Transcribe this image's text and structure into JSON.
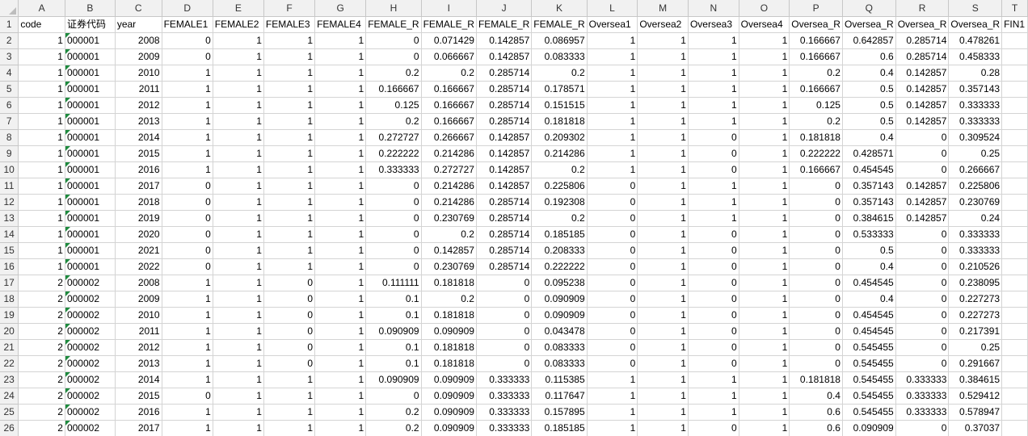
{
  "columns": [
    "A",
    "B",
    "C",
    "D",
    "E",
    "F",
    "G",
    "H",
    "I",
    "J",
    "K",
    "L",
    "M",
    "N",
    "O",
    "P",
    "Q",
    "R",
    "S",
    "T"
  ],
  "rows": [
    {
      "n": "1",
      "c": [
        "code",
        "证券代码",
        "year",
        "FEMALE1",
        "FEMALE2",
        "FEMALE3",
        "FEMALE4",
        "FEMALE_R",
        "FEMALE_R",
        "FEMALE_R",
        "FEMALE_R",
        "Oversea1",
        "Oversea2",
        "Oversea3",
        "Oversea4",
        "Oversea_R",
        "Oversea_R",
        "Oversea_R",
        "Oversea_R",
        "FIN1"
      ]
    },
    {
      "n": "2",
      "c": [
        "1",
        "000001",
        "2008",
        "0",
        "1",
        "1",
        "1",
        "0",
        "0.071429",
        "0.142857",
        "0.086957",
        "1",
        "1",
        "1",
        "1",
        "0.166667",
        "0.642857",
        "0.285714",
        "0.478261",
        ""
      ]
    },
    {
      "n": "3",
      "c": [
        "1",
        "000001",
        "2009",
        "0",
        "1",
        "1",
        "1",
        "0",
        "0.066667",
        "0.142857",
        "0.083333",
        "1",
        "1",
        "1",
        "1",
        "0.166667",
        "0.6",
        "0.285714",
        "0.458333",
        ""
      ]
    },
    {
      "n": "4",
      "c": [
        "1",
        "000001",
        "2010",
        "1",
        "1",
        "1",
        "1",
        "0.2",
        "0.2",
        "0.285714",
        "0.2",
        "1",
        "1",
        "1",
        "1",
        "0.2",
        "0.4",
        "0.142857",
        "0.28",
        ""
      ]
    },
    {
      "n": "5",
      "c": [
        "1",
        "000001",
        "2011",
        "1",
        "1",
        "1",
        "1",
        "0.166667",
        "0.166667",
        "0.285714",
        "0.178571",
        "1",
        "1",
        "1",
        "1",
        "0.166667",
        "0.5",
        "0.142857",
        "0.357143",
        ""
      ]
    },
    {
      "n": "6",
      "c": [
        "1",
        "000001",
        "2012",
        "1",
        "1",
        "1",
        "1",
        "0.125",
        "0.166667",
        "0.285714",
        "0.151515",
        "1",
        "1",
        "1",
        "1",
        "0.125",
        "0.5",
        "0.142857",
        "0.333333",
        ""
      ]
    },
    {
      "n": "7",
      "c": [
        "1",
        "000001",
        "2013",
        "1",
        "1",
        "1",
        "1",
        "0.2",
        "0.166667",
        "0.285714",
        "0.181818",
        "1",
        "1",
        "1",
        "1",
        "0.2",
        "0.5",
        "0.142857",
        "0.333333",
        ""
      ]
    },
    {
      "n": "8",
      "c": [
        "1",
        "000001",
        "2014",
        "1",
        "1",
        "1",
        "1",
        "0.272727",
        "0.266667",
        "0.142857",
        "0.209302",
        "1",
        "1",
        "0",
        "1",
        "0.181818",
        "0.4",
        "0",
        "0.309524",
        ""
      ]
    },
    {
      "n": "9",
      "c": [
        "1",
        "000001",
        "2015",
        "1",
        "1",
        "1",
        "1",
        "0.222222",
        "0.214286",
        "0.142857",
        "0.214286",
        "1",
        "1",
        "0",
        "1",
        "0.222222",
        "0.428571",
        "0",
        "0.25",
        ""
      ]
    },
    {
      "n": "10",
      "c": [
        "1",
        "000001",
        "2016",
        "1",
        "1",
        "1",
        "1",
        "0.333333",
        "0.272727",
        "0.142857",
        "0.2",
        "1",
        "1",
        "0",
        "1",
        "0.166667",
        "0.454545",
        "0",
        "0.266667",
        ""
      ]
    },
    {
      "n": "11",
      "c": [
        "1",
        "000001",
        "2017",
        "0",
        "1",
        "1",
        "1",
        "0",
        "0.214286",
        "0.142857",
        "0.225806",
        "0",
        "1",
        "1",
        "1",
        "0",
        "0.357143",
        "0.142857",
        "0.225806",
        ""
      ]
    },
    {
      "n": "12",
      "c": [
        "1",
        "000001",
        "2018",
        "0",
        "1",
        "1",
        "1",
        "0",
        "0.214286",
        "0.285714",
        "0.192308",
        "0",
        "1",
        "1",
        "1",
        "0",
        "0.357143",
        "0.142857",
        "0.230769",
        ""
      ]
    },
    {
      "n": "13",
      "c": [
        "1",
        "000001",
        "2019",
        "0",
        "1",
        "1",
        "1",
        "0",
        "0.230769",
        "0.285714",
        "0.2",
        "0",
        "1",
        "1",
        "1",
        "0",
        "0.384615",
        "0.142857",
        "0.24",
        ""
      ]
    },
    {
      "n": "14",
      "c": [
        "1",
        "000001",
        "2020",
        "0",
        "1",
        "1",
        "1",
        "0",
        "0.2",
        "0.285714",
        "0.185185",
        "0",
        "1",
        "0",
        "1",
        "0",
        "0.533333",
        "0",
        "0.333333",
        ""
      ]
    },
    {
      "n": "15",
      "c": [
        "1",
        "000001",
        "2021",
        "0",
        "1",
        "1",
        "1",
        "0",
        "0.142857",
        "0.285714",
        "0.208333",
        "0",
        "1",
        "0",
        "1",
        "0",
        "0.5",
        "0",
        "0.333333",
        ""
      ]
    },
    {
      "n": "16",
      "c": [
        "1",
        "000001",
        "2022",
        "0",
        "1",
        "1",
        "1",
        "0",
        "0.230769",
        "0.285714",
        "0.222222",
        "0",
        "1",
        "0",
        "1",
        "0",
        "0.4",
        "0",
        "0.210526",
        ""
      ]
    },
    {
      "n": "17",
      "c": [
        "2",
        "000002",
        "2008",
        "1",
        "1",
        "0",
        "1",
        "0.111111",
        "0.181818",
        "0",
        "0.095238",
        "0",
        "1",
        "0",
        "1",
        "0",
        "0.454545",
        "0",
        "0.238095",
        ""
      ]
    },
    {
      "n": "18",
      "c": [
        "2",
        "000002",
        "2009",
        "1",
        "1",
        "0",
        "1",
        "0.1",
        "0.2",
        "0",
        "0.090909",
        "0",
        "1",
        "0",
        "1",
        "0",
        "0.4",
        "0",
        "0.227273",
        ""
      ]
    },
    {
      "n": "19",
      "c": [
        "2",
        "000002",
        "2010",
        "1",
        "1",
        "0",
        "1",
        "0.1",
        "0.181818",
        "0",
        "0.090909",
        "0",
        "1",
        "0",
        "1",
        "0",
        "0.454545",
        "0",
        "0.227273",
        ""
      ]
    },
    {
      "n": "20",
      "c": [
        "2",
        "000002",
        "2011",
        "1",
        "1",
        "0",
        "1",
        "0.090909",
        "0.090909",
        "0",
        "0.043478",
        "0",
        "1",
        "0",
        "1",
        "0",
        "0.454545",
        "0",
        "0.217391",
        ""
      ]
    },
    {
      "n": "21",
      "c": [
        "2",
        "000002",
        "2012",
        "1",
        "1",
        "0",
        "1",
        "0.1",
        "0.181818",
        "0",
        "0.083333",
        "0",
        "1",
        "0",
        "1",
        "0",
        "0.545455",
        "0",
        "0.25",
        ""
      ]
    },
    {
      "n": "22",
      "c": [
        "2",
        "000002",
        "2013",
        "1",
        "1",
        "0",
        "1",
        "0.1",
        "0.181818",
        "0",
        "0.083333",
        "0",
        "1",
        "0",
        "1",
        "0",
        "0.545455",
        "0",
        "0.291667",
        ""
      ]
    },
    {
      "n": "23",
      "c": [
        "2",
        "000002",
        "2014",
        "1",
        "1",
        "1",
        "1",
        "0.090909",
        "0.090909",
        "0.333333",
        "0.115385",
        "1",
        "1",
        "1",
        "1",
        "0.181818",
        "0.545455",
        "0.333333",
        "0.384615",
        ""
      ]
    },
    {
      "n": "24",
      "c": [
        "2",
        "000002",
        "2015",
        "0",
        "1",
        "1",
        "1",
        "0",
        "0.090909",
        "0.333333",
        "0.117647",
        "1",
        "1",
        "1",
        "1",
        "0.4",
        "0.545455",
        "0.333333",
        "0.529412",
        ""
      ]
    },
    {
      "n": "25",
      "c": [
        "2",
        "000002",
        "2016",
        "1",
        "1",
        "1",
        "1",
        "0.2",
        "0.090909",
        "0.333333",
        "0.157895",
        "1",
        "1",
        "1",
        "1",
        "0.6",
        "0.545455",
        "0.333333",
        "0.578947",
        ""
      ]
    },
    {
      "n": "26",
      "c": [
        "2",
        "000002",
        "2017",
        "1",
        "1",
        "1",
        "1",
        "0.2",
        "0.090909",
        "0.333333",
        "0.185185",
        "1",
        "1",
        "0",
        "1",
        "0.6",
        "0.090909",
        "0",
        "0.37037",
        ""
      ]
    }
  ]
}
